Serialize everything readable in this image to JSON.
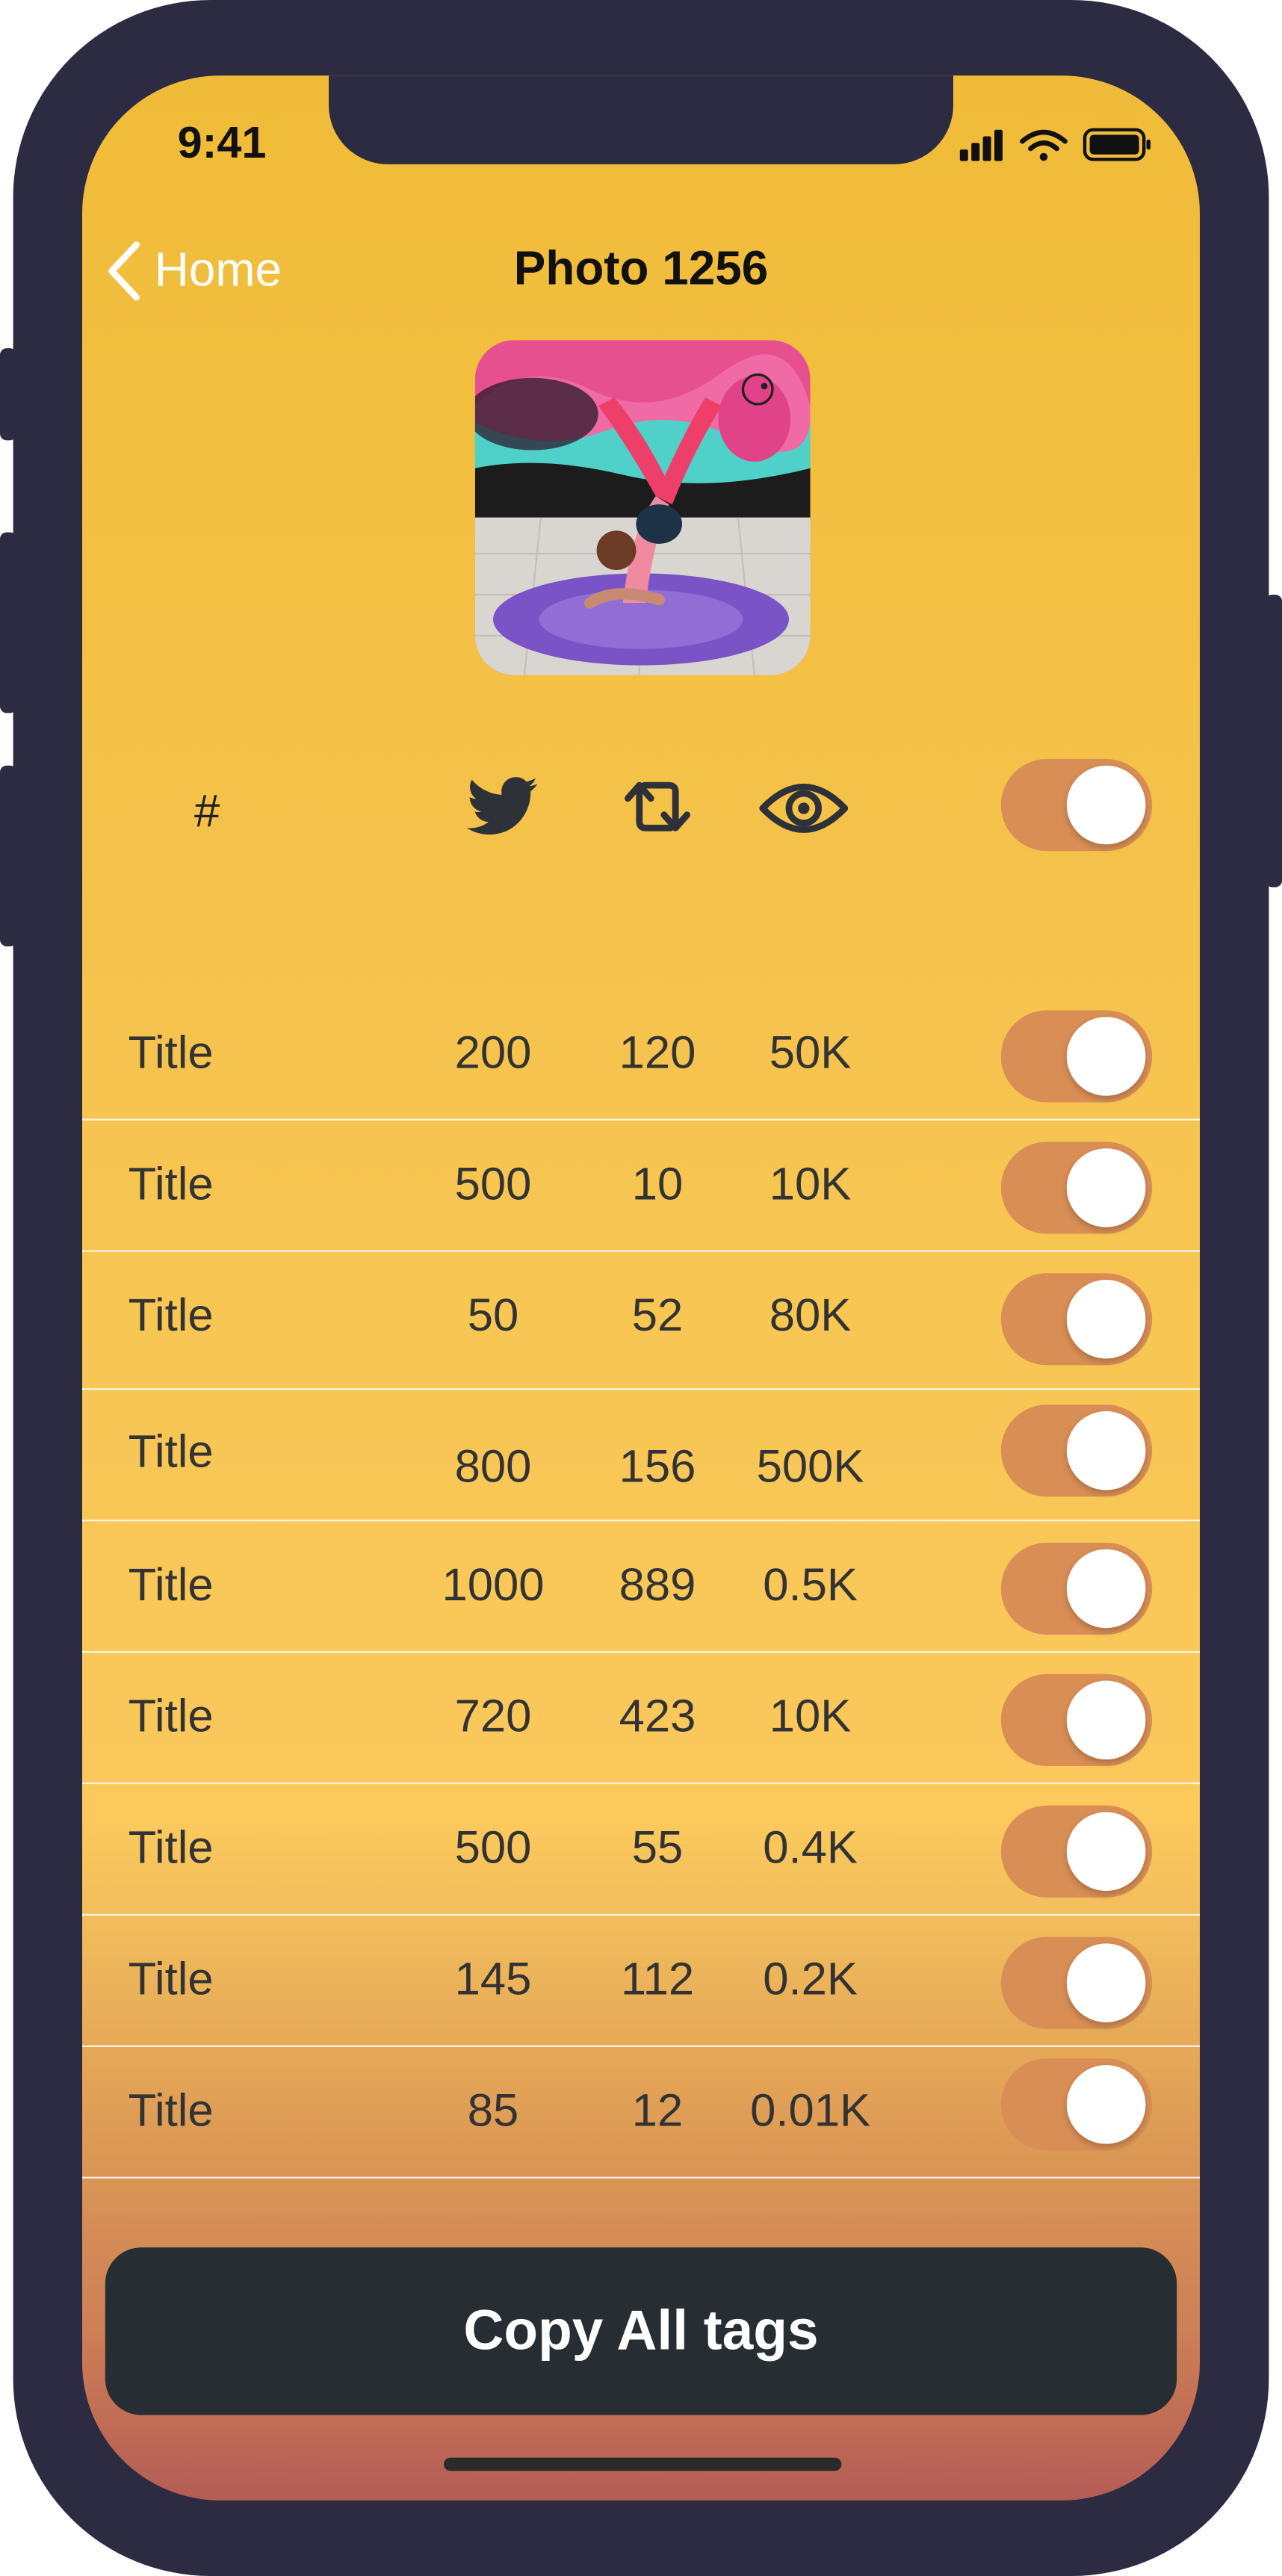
{
  "status_bar": {
    "time": "9:41"
  },
  "nav": {
    "back_label": "Home",
    "title": "Photo 1256"
  },
  "header": {
    "hash_label": "#",
    "icons": [
      "twitter-icon",
      "retweet-icon",
      "eye-icon"
    ]
  },
  "master_toggle": {
    "on": true
  },
  "rows": [
    {
      "title": "Title",
      "likes": "200",
      "retweets": "120",
      "views": "50K",
      "on": true
    },
    {
      "title": "Title",
      "likes": "500",
      "retweets": "10",
      "views": "10K",
      "on": true
    },
    {
      "title": "Title",
      "likes": "50",
      "retweets": "52",
      "views": "80K",
      "on": true
    },
    {
      "title": "Title",
      "likes": "800",
      "retweets": "156",
      "views": "500K",
      "on": true
    },
    {
      "title": "Title",
      "likes": "1000",
      "retweets": "889",
      "views": "0.5K",
      "on": true
    },
    {
      "title": "Title",
      "likes": "720",
      "retweets": "423",
      "views": "10K",
      "on": true
    },
    {
      "title": "Title",
      "likes": "500",
      "retweets": "55",
      "views": "0.4K",
      "on": true
    },
    {
      "title": "Title",
      "likes": "145",
      "retweets": "112",
      "views": "0.2K",
      "on": true
    },
    {
      "title": "Title",
      "likes": "85",
      "retweets": "12",
      "views": "0.01K",
      "on": true
    }
  ],
  "copy_button": {
    "label": "Copy All tags"
  },
  "colors": {
    "background_top": "#f0bb38",
    "background_bottom": "#b45c56",
    "toggle_track": "#d98e55",
    "button": "#262d33",
    "device_frame": "#2c2b41"
  }
}
